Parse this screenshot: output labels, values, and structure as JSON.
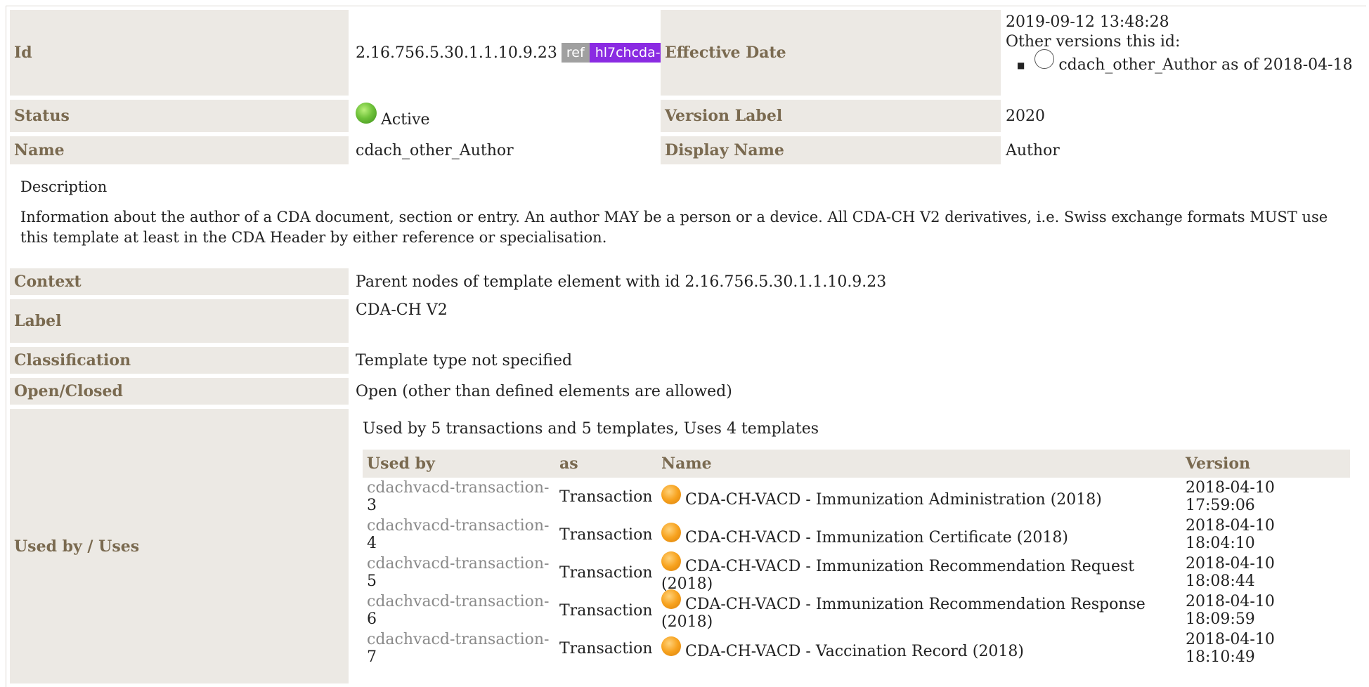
{
  "rows": {
    "id": {
      "label": "Id",
      "value": "2.16.756.5.30.1.1.10.9.23",
      "ref_badge": "ref",
      "prefix_badge": "hl7chcda-"
    },
    "effective_date": {
      "label": "Effective Date",
      "value": "2019-09-12 13:48:28",
      "other_versions_label": "Other versions this id:",
      "other_versions": [
        "cdach_other_Author as of 2018-04-18"
      ]
    },
    "status": {
      "label": "Status",
      "value": "Active"
    },
    "version_label": {
      "label": "Version Label",
      "value": "2020"
    },
    "name": {
      "label": "Name",
      "value": "cdach_other_Author"
    },
    "display_name": {
      "label": "Display Name",
      "value": "Author"
    },
    "description": {
      "label": "Description",
      "text": "Information about the author of a CDA document, section or entry. An author MAY be a person or a device. All CDA-CH V2 derivatives, i.e. Swiss exchange formats MUST use this template at least in the CDA Header by either reference or specialisation."
    },
    "context": {
      "label": "Context",
      "value": "Parent nodes of template element with id 2.16.756.5.30.1.1.10.9.23"
    },
    "label": {
      "label": "Label",
      "value": "CDA-CH V2"
    },
    "classification": {
      "label": "Classification",
      "value": "Template type not specified"
    },
    "open_closed": {
      "label": "Open/Closed",
      "value": "Open (other than defined elements are allowed)"
    },
    "used_by": {
      "label": "Used by / Uses",
      "summary": "Used by 5 transactions and 5 templates, Uses 4 templates"
    }
  },
  "used_table": {
    "headers": [
      "Used by",
      "as",
      "Name",
      "Version"
    ],
    "rows": [
      {
        "prefix": "cdachvacd-transaction-",
        "num": "3",
        "as": "Transaction",
        "name": "CDA-CH-VACD - Immunization Administration (2018)",
        "version": "2018-04-10 17:59:06"
      },
      {
        "prefix": "cdachvacd-transaction-",
        "num": "4",
        "as": "Transaction",
        "name": "CDA-CH-VACD - Immunization Certificate (2018)",
        "version": "2018-04-10 18:04:10"
      },
      {
        "prefix": "cdachvacd-transaction-",
        "num": "5",
        "as": "Transaction",
        "name": "CDA-CH-VACD - Immunization Recommendation Request (2018)",
        "version": "2018-04-10 18:08:44"
      },
      {
        "prefix": "cdachvacd-transaction-",
        "num": "6",
        "as": "Transaction",
        "name": "CDA-CH-VACD - Immunization Recommendation Response (2018)",
        "version": "2018-04-10 18:09:59"
      },
      {
        "prefix": "cdachvacd-transaction-",
        "num": "7",
        "as": "Transaction",
        "name": "CDA-CH-VACD - Vaccination Record (2018)",
        "version": "2018-04-10 18:10:49"
      }
    ]
  },
  "colors": {
    "label_bg": "#ece9e4",
    "label_text": "#7a6a50",
    "ref_badge": "#a0a0a0",
    "prefix_badge": "#8a2be2",
    "status_active": "#6fc23a",
    "status_draft": "#f7a21e"
  }
}
